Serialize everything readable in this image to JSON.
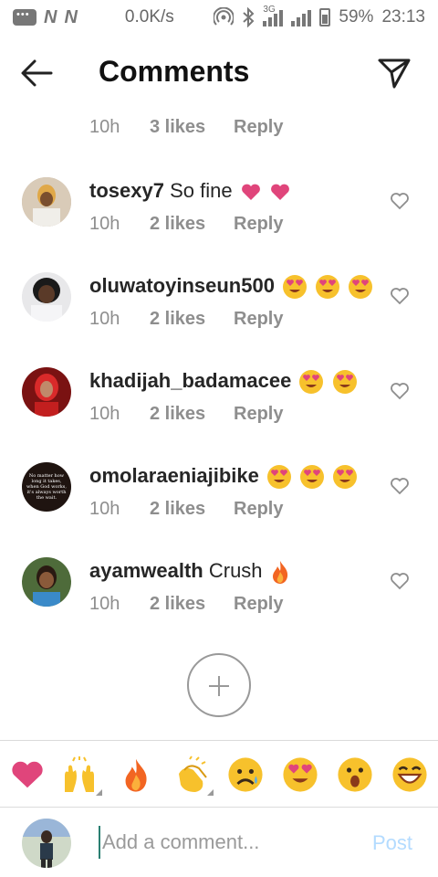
{
  "status_bar": {
    "speed": "0.0K/s",
    "network": "3G",
    "battery": "59%",
    "time": "23:13"
  },
  "header": {
    "title": "Comments"
  },
  "comments": [
    {
      "username": "",
      "text": "",
      "time": "10h",
      "likes": "3 likes",
      "reply": "Reply"
    },
    {
      "username": "tosexy7",
      "text": "So fine",
      "emojis": [
        "pink-heart",
        "pink-heart"
      ],
      "time": "10h",
      "likes": "2 likes",
      "reply": "Reply"
    },
    {
      "username": "oluwatoyinseun500",
      "text": "",
      "emojis": [
        "heart-eyes",
        "heart-eyes",
        "heart-eyes"
      ],
      "time": "10h",
      "likes": "2 likes",
      "reply": "Reply"
    },
    {
      "username": "khadijah_badamacee",
      "text": "",
      "emojis": [
        "heart-eyes",
        "heart-eyes"
      ],
      "time": "10h",
      "likes": "2 likes",
      "reply": "Reply"
    },
    {
      "username": "omolaraeniajibike",
      "text": "",
      "emojis": [
        "heart-eyes",
        "heart-eyes",
        "heart-eyes"
      ],
      "time": "10h",
      "likes": "2 likes",
      "reply": "Reply"
    },
    {
      "username": "ayamwealth",
      "text": "Crush",
      "emojis": [
        "fire"
      ],
      "time": "10h",
      "likes": "2 likes",
      "reply": "Reply"
    }
  ],
  "avatar_text": {
    "omolaraeniajibike": "No matter how long it takes, when God works, it's always worth the wait."
  },
  "emoji_bar": [
    "heart",
    "raised-hands",
    "fire",
    "clapping-hands",
    "sad-face",
    "heart-eyes",
    "surprised-face",
    "grinning-face"
  ],
  "input": {
    "placeholder": "Add a comment...",
    "post_label": "Post"
  },
  "colors": {
    "pink": "#e0457b",
    "post_disabled": "#b3dbff",
    "meta_gray": "#8e8e8e"
  }
}
